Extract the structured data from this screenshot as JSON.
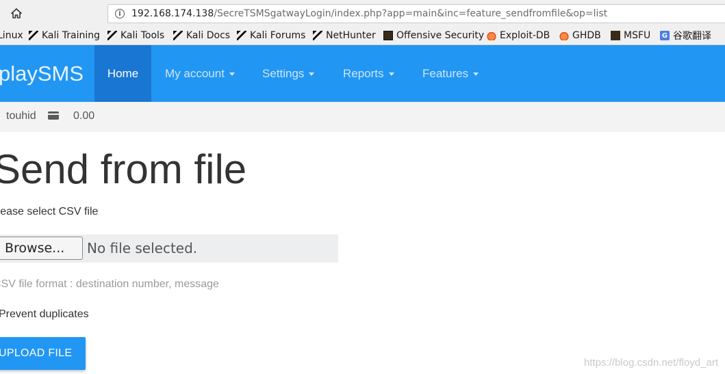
{
  "browser": {
    "url_host": "192.168.174.138",
    "url_path": "/SecreTSMSgatwayLogin/index.php?app=main&inc=feature_sendfromfile&op=list",
    "bookmarks": [
      {
        "label": "Linux",
        "icon": "kali-dragon-icon"
      },
      {
        "label": "Kali Training",
        "icon": "kali-dragon-icon"
      },
      {
        "label": "Kali Tools",
        "icon": "kali-dragon-icon"
      },
      {
        "label": "Kali Docs",
        "icon": "kali-dragon-icon"
      },
      {
        "label": "Kali Forums",
        "icon": "kali-dragon-icon"
      },
      {
        "label": "NetHunter",
        "icon": "kali-dragon-icon"
      },
      {
        "label": "Offensive Security",
        "icon": "offsec-icon"
      },
      {
        "label": "Exploit-DB",
        "icon": "exploit-db-icon"
      },
      {
        "label": "GHDB",
        "icon": "ghdb-icon"
      },
      {
        "label": "MSFU",
        "icon": "msfu-icon"
      },
      {
        "label": "谷歌翻译",
        "icon": "google-translate-icon"
      }
    ]
  },
  "app": {
    "brand": "playSMS",
    "nav": [
      {
        "label": "Home",
        "active": true
      },
      {
        "label": "My account",
        "dropdown": true
      },
      {
        "label": "Settings",
        "dropdown": true
      },
      {
        "label": "Reports",
        "dropdown": true
      },
      {
        "label": "Features",
        "dropdown": true
      }
    ],
    "colors": {
      "navbar": "#2196f3",
      "active": "#1976d2"
    }
  },
  "infobar": {
    "username": "touhid",
    "credit_icon": "credit-card-icon",
    "credit": "0.00"
  },
  "main": {
    "title": "Send from file",
    "select_label": "Please select CSV file",
    "browse_label": "Browse...",
    "file_status": "No file selected.",
    "format_help": "CSV file format : destination number, message",
    "duplicates_label": "Prevent duplicates",
    "upload_label": "UPLOAD FILE"
  },
  "watermark": "https://blog.csdn.net/floyd_art"
}
